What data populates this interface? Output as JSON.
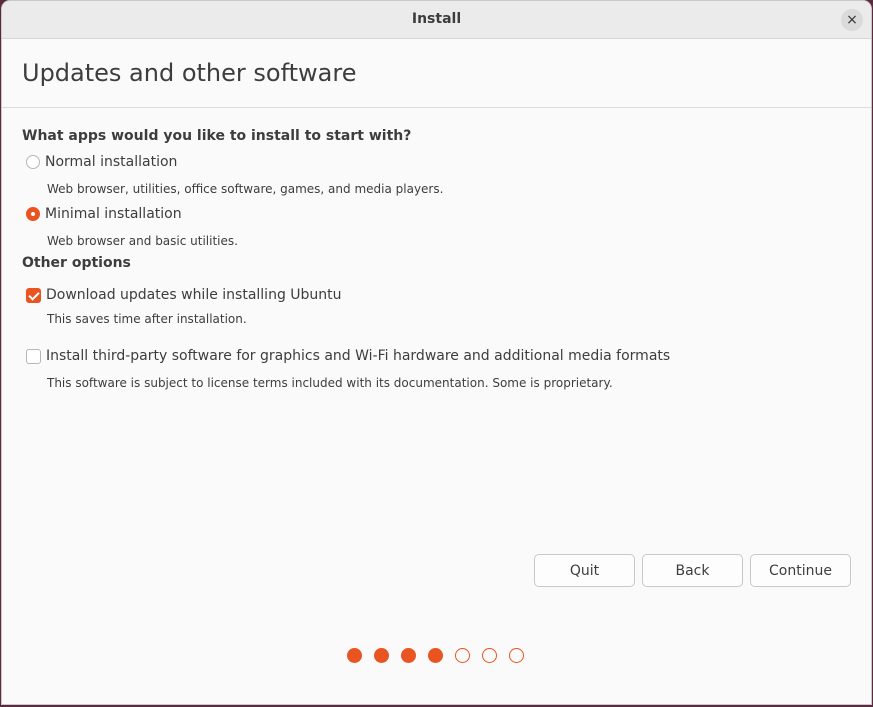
{
  "window": {
    "title": "Install",
    "close_label": "×"
  },
  "page": {
    "title": "Updates and other software"
  },
  "apps_section": {
    "question": "What apps would you like to install to start with?",
    "options": [
      {
        "label": "Normal installation",
        "description": "Web browser, utilities, office software, games, and media players.",
        "selected": false
      },
      {
        "label": "Minimal installation",
        "description": "Web browser and basic utilities.",
        "selected": true
      }
    ]
  },
  "other_options": {
    "heading": "Other options",
    "items": [
      {
        "label": "Download updates while installing Ubuntu",
        "description": "This saves time after installation.",
        "checked": true
      },
      {
        "label": "Install third-party software for graphics and Wi-Fi hardware and additional media formats",
        "description": "This software is subject to license terms included with its documentation. Some is proprietary.",
        "checked": false
      }
    ]
  },
  "buttons": {
    "quit": "Quit",
    "back": "Back",
    "continue": "Continue"
  },
  "progress": {
    "current_step": 4,
    "total_steps": 7
  },
  "colors": {
    "accent": "#e95420"
  }
}
